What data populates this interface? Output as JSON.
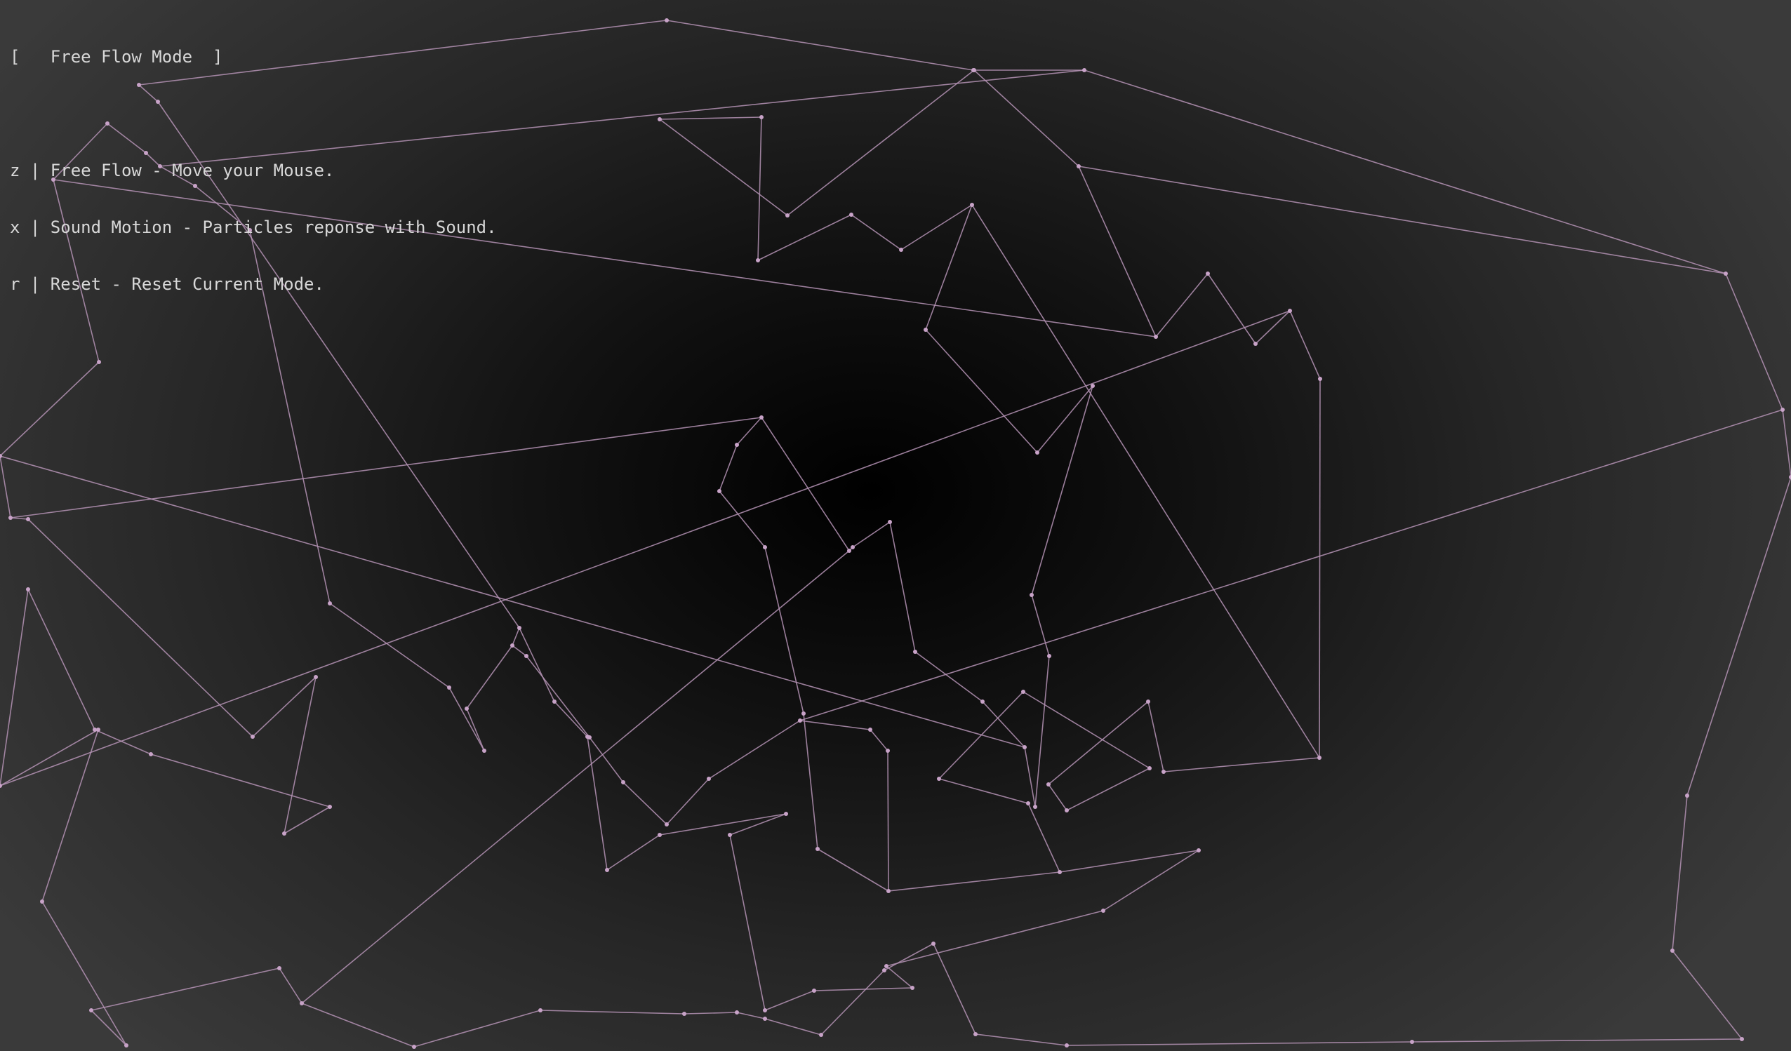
{
  "window": {
    "mode_title": "[   Free Flow Mode  ]"
  },
  "controls": [
    {
      "key": "z",
      "text": "z | Free Flow - Move your Mouse."
    },
    {
      "key": "x",
      "text": "x | Sound Motion - Particles reponse with Sound."
    },
    {
      "key": "r",
      "text": "r | Reset - Reset Current Mode."
    }
  ],
  "colors": {
    "line": "#b593b5",
    "point": "#c8a3c8",
    "text": "#d8d8d8",
    "background_center": "#000000",
    "background_edge": "#3a3a3a"
  }
}
